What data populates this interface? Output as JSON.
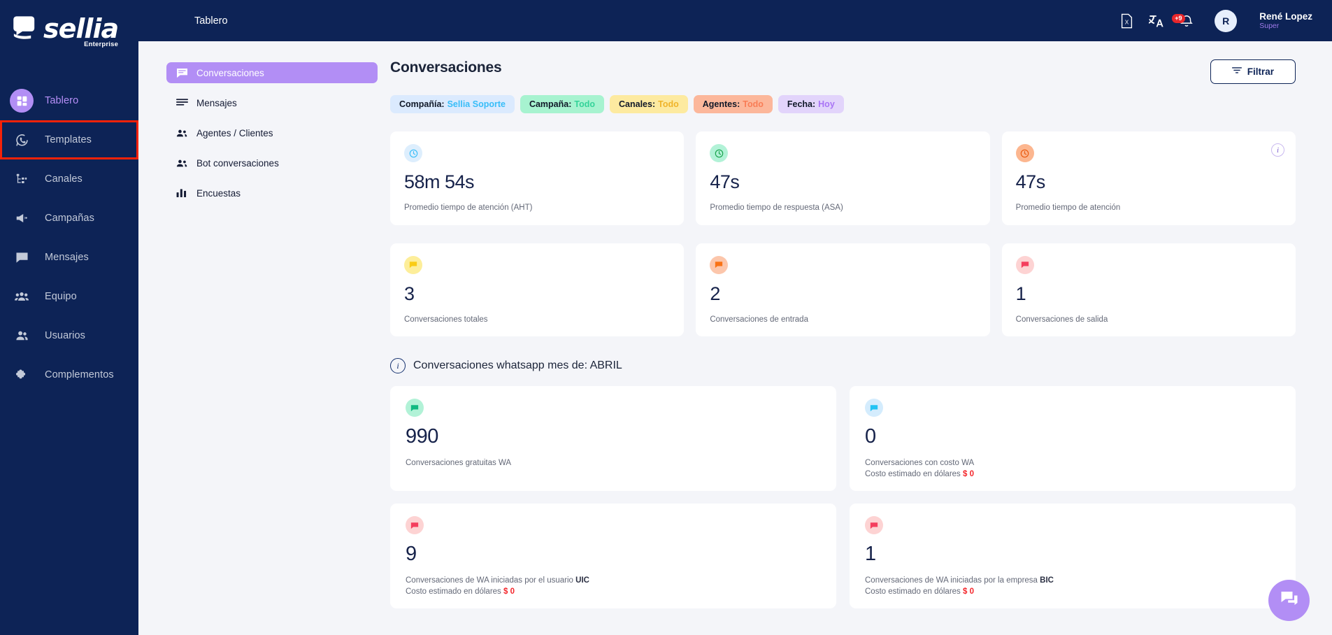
{
  "brand": {
    "name": "sellia",
    "edition": "Enterprise",
    "logo_icon": "sellia-logo-icon"
  },
  "colors": {
    "sidebar_bg": "#0d2356",
    "accent_purple": "#b28ef5",
    "page_bg": "#f4f5f9",
    "danger_red": "#f4262b",
    "highlight_outline": "#f42209"
  },
  "sidebar": {
    "items": [
      {
        "label": "Tablero",
        "icon": "dashboard-grid-icon",
        "active": true,
        "highlighted": false
      },
      {
        "label": "Templates",
        "icon": "whatsapp-icon",
        "active": false,
        "highlighted": true
      },
      {
        "label": "Canales",
        "icon": "sitemap-icon",
        "active": false,
        "highlighted": false
      },
      {
        "label": "Campañas",
        "icon": "megaphone-icon",
        "active": false,
        "highlighted": false
      },
      {
        "label": "Mensajes",
        "icon": "chat-bubble-icon",
        "active": false,
        "highlighted": false
      },
      {
        "label": "Equipo",
        "icon": "users-group-icon",
        "active": false,
        "highlighted": false
      },
      {
        "label": "Usuarios",
        "icon": "user-pair-icon",
        "active": false,
        "highlighted": false
      },
      {
        "label": "Complementos",
        "icon": "puzzle-piece-icon",
        "active": false,
        "highlighted": false
      }
    ]
  },
  "topbar": {
    "title": "Tablero",
    "icons": [
      {
        "name": "excel-export-icon"
      },
      {
        "name": "translate-icon"
      },
      {
        "name": "notification-bell-icon",
        "badge": "+9"
      }
    ],
    "user": {
      "initial": "R",
      "name": "René Lopez",
      "role": "Super"
    }
  },
  "submenu": {
    "items": [
      {
        "label": "Conversaciones",
        "icon": "chat-lines-icon",
        "active": true
      },
      {
        "label": "Mensajes",
        "icon": "list-lines-icon",
        "active": false
      },
      {
        "label": "Agentes / Clientes",
        "icon": "users-group-icon",
        "active": false
      },
      {
        "label": "Bot conversaciones",
        "icon": "users-group-icon",
        "active": false
      },
      {
        "label": "Encuestas",
        "icon": "bar-chart-icon",
        "active": false
      }
    ]
  },
  "main": {
    "page_title": "Conversaciones",
    "filter_button": {
      "label": "Filtrar",
      "icon": "filter-icon"
    },
    "chips": [
      {
        "key": "Compañía:",
        "value": "Sellia Soporte",
        "bg": "#dbeafe",
        "value_color": "#38bdf8"
      },
      {
        "key": "Campaña:",
        "value": "Todo",
        "bg": "#a7f3d0",
        "value_color": "#34d399"
      },
      {
        "key": "Canales:",
        "value": "Todo",
        "bg": "#fdeaa0",
        "value_color": "#f0b429"
      },
      {
        "key": "Agentes:",
        "value": "Todo",
        "bg": "#fcb79b",
        "value_color": "#f97d56"
      },
      {
        "key": "Fecha:",
        "value": "Hoy",
        "bg": "#e2d4fb",
        "value_color": "#a974f5"
      }
    ],
    "metric_cards_row1": [
      {
        "value": "58m 54s",
        "caption": "Promedio tiempo de atención (AHT)",
        "icon": "clock-icon",
        "icon_bg": "#ddeefd",
        "icon_color": "#38bdf8",
        "info": false
      },
      {
        "value": "47s",
        "caption": "Promedio tiempo de respuesta (ASA)",
        "icon": "clock-icon",
        "icon_bg": "#b2f2d7",
        "icon_color": "#16a34a",
        "info": false
      },
      {
        "value": "47s",
        "caption": "Promedio tiempo de atención",
        "icon": "clock-icon",
        "icon_bg": "#fcb68f",
        "icon_color": "#ea580c",
        "info": true,
        "info_label": "i"
      }
    ],
    "metric_cards_row2": [
      {
        "value": "3",
        "caption": "Conversaciones totales",
        "icon": "chat-bubble-icon",
        "icon_bg": "#fdee9a",
        "icon_color": "#facc15"
      },
      {
        "value": "2",
        "caption": "Conversaciones de entrada",
        "icon": "chat-bubble-icon",
        "icon_bg": "#fcc6ab",
        "icon_color": "#f97316"
      },
      {
        "value": "1",
        "caption": "Conversaciones de salida",
        "icon": "chat-bubble-icon",
        "icon_bg": "#fdd3d3",
        "icon_color": "#f43f5e"
      }
    ],
    "wa_section": {
      "title": "Conversaciones whatsapp mes de: ABRIL",
      "info_label": "i",
      "cards": [
        {
          "value": "990",
          "caption": "Conversaciones gratuitas WA",
          "caption_bold": "",
          "cost_label": "",
          "cost_value": "",
          "icon": "chat-bubble-icon",
          "icon_bg": "#b2f2d7",
          "icon_color": "#10b981"
        },
        {
          "value": "0",
          "caption": "Conversaciones con costo WA",
          "caption_bold": "",
          "cost_label": "Costo estimado en dólares",
          "cost_value": "$ 0",
          "icon": "chat-bubble-icon",
          "icon_bg": "#d4ecfd",
          "icon_color": "#22c3f3"
        },
        {
          "value": "9",
          "caption": "Conversaciones de WA iniciadas por el usuario",
          "caption_bold": "UIC",
          "cost_label": "Costo estimado en dólares",
          "cost_value": "$ 0",
          "icon": "chat-bubble-icon",
          "icon_bg": "#fdd3d3",
          "icon_color": "#f43f5e"
        },
        {
          "value": "1",
          "caption": "Conversaciones de WA iniciadas por la empresa",
          "caption_bold": "BIC",
          "cost_label": "Costo estimado en dólares",
          "cost_value": "$ 0",
          "icon": "chat-bubble-icon",
          "icon_bg": "#fdd3d3",
          "icon_color": "#f43f5e"
        }
      ]
    },
    "fab": {
      "icon": "chat-support-icon"
    }
  }
}
